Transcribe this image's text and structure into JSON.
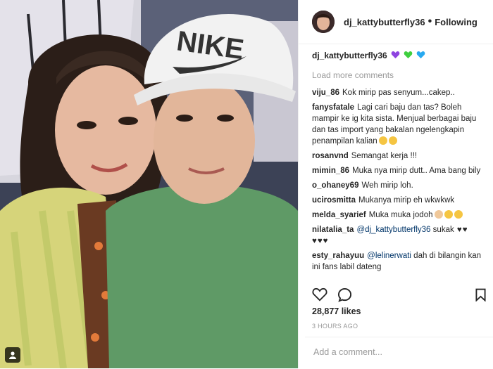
{
  "post": {
    "author": "dj_kattybutterfly36",
    "follow_status": "Following",
    "separator": "•",
    "caption_user": "dj_kattybutterfly36",
    "caption_hearts": [
      "purple-heart",
      "green-heart",
      "blue-heart"
    ],
    "load_more": "Load more comments",
    "likes": "28,877 likes",
    "time": "3 HOURS AGO",
    "comment_placeholder": "Add a comment...",
    "photo_cap_text": "NIKE"
  },
  "comments": [
    {
      "user": "viju_86",
      "text": "Kok mirip pas senyum...cakep.."
    },
    {
      "user": "fanysfatale",
      "text": "Lagi cari baju dan tas? Boleh mampir ke ig kita sista. Menjual berbagai baju dan tas import yang bakalan ngelengkapin penampilan kalian"
    },
    {
      "user": "rosanvnd",
      "text": "Semangat kerja !!!"
    },
    {
      "user": "mimin_86",
      "text": "Muka nya mirip dutt.. Ama bang bily"
    },
    {
      "user": "o_ohaney69",
      "text": "Weh mirip loh."
    },
    {
      "user": "ucirosmitta",
      "text": "Mukanya mirip eh wkwkwk"
    },
    {
      "user": "melda_syarief",
      "text": "Muka muka jodoh"
    },
    {
      "user": "nilatalia_ta",
      "mention": "@dj_kattybutterfly36",
      "text": "sukak"
    },
    {
      "user": "esty_rahayuu",
      "mention": "@lelinerwati",
      "text": "dah di bilangin kan ini fans labil dateng"
    }
  ],
  "colors": {
    "purple": "#8e44e0",
    "green": "#3ecf3e",
    "blue": "#27a9f0",
    "border": "#efefef",
    "muted": "#999999",
    "link": "#003569"
  }
}
